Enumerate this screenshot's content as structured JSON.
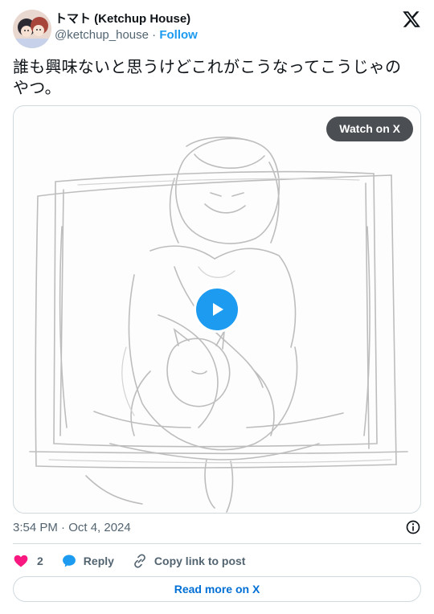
{
  "author": {
    "display_name": "トマト (Ketchup House)",
    "handle": "@ketchup_house",
    "separator": " · ",
    "follow_label": "Follow"
  },
  "tweet": {
    "text": "誰も興味ないと思うけどこれがこうなってこうじゃのやつ。"
  },
  "media": {
    "watch_label": "Watch on X"
  },
  "meta": {
    "timestamp": "3:54 PM · Oct 4, 2024"
  },
  "actions": {
    "like_count": "2",
    "reply_label": "Reply",
    "copy_label": "Copy link to post"
  },
  "footer": {
    "read_more_label": "Read more on X"
  },
  "colors": {
    "accent": "#1d9bf0",
    "like": "#f91880",
    "muted": "#536471",
    "link": "#006fd6"
  },
  "icons": [
    "x-logo-icon",
    "play-icon",
    "info-icon",
    "heart-icon",
    "reply-icon",
    "link-icon"
  ]
}
